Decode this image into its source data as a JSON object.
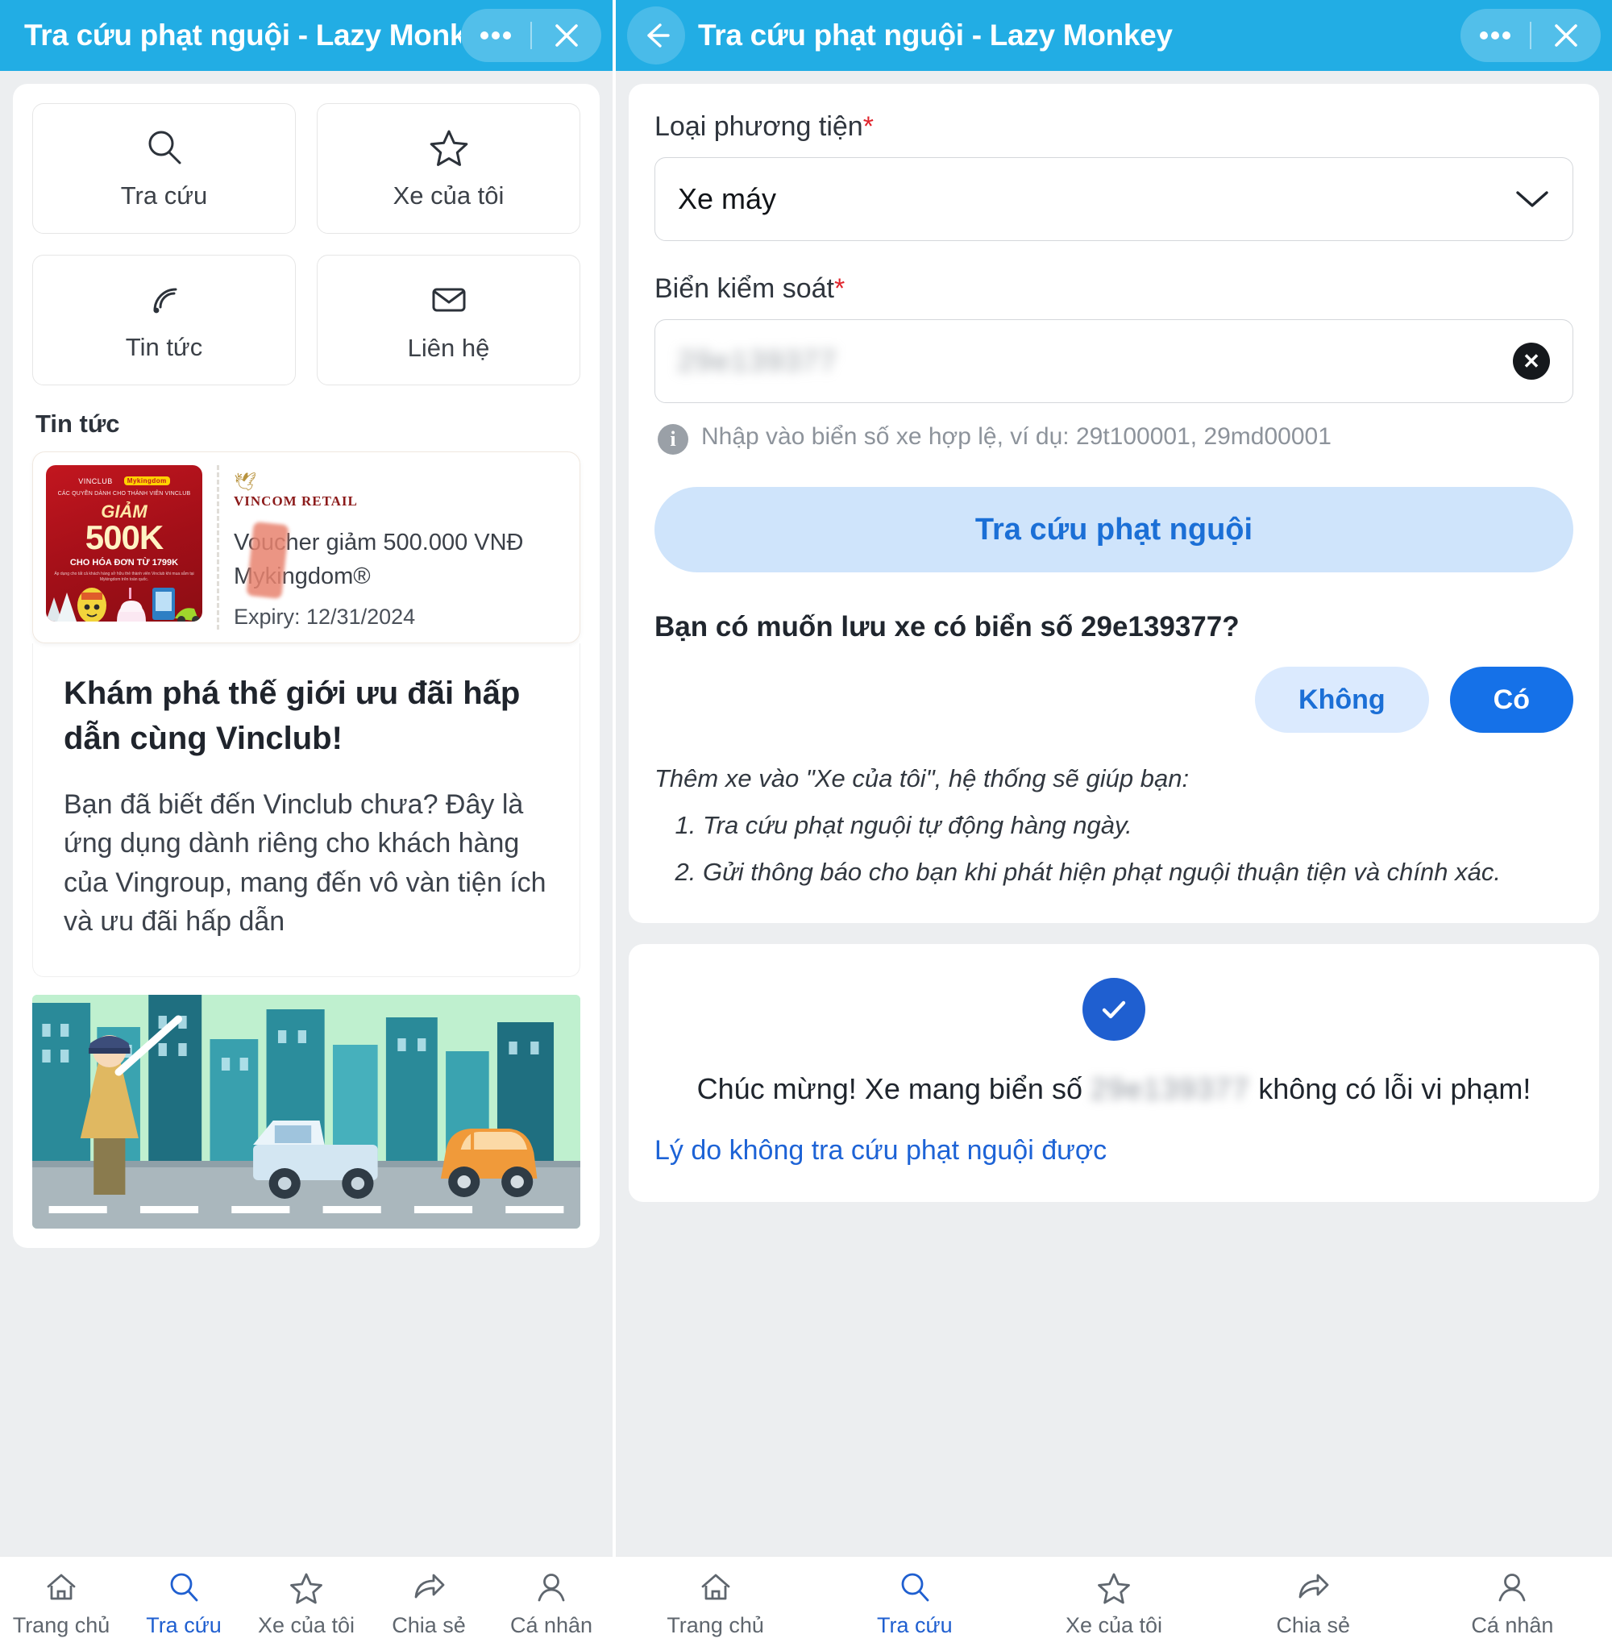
{
  "header": {
    "title": "Tra cứu phạt nguội - Lazy Monkey",
    "more_label": "•••",
    "close_label": "✕"
  },
  "left": {
    "tiles": [
      {
        "label": "Tra cứu",
        "icon": "search-icon"
      },
      {
        "label": "Xe của tôi",
        "icon": "star-icon"
      },
      {
        "label": "Tin tức",
        "icon": "rss-icon"
      },
      {
        "label": "Liên hệ",
        "icon": "mail-icon"
      }
    ],
    "news_section_title": "Tin tức",
    "voucher": {
      "brand_left": "VINCLUB",
      "brand_right": "Mykingdom",
      "promo_sub": "CÁC QUYỀN DÀNH CHO THÀNH VIÊN VINCLUB",
      "promo_giam": "GIẢM",
      "promo_amount": "500K",
      "promo_condition": "CHO HÓA ĐƠN TỪ 1799K",
      "promo_fine": "Áp dụng cho tất cả khách hàng sở hữu thẻ thành viên Vinclub khi mua sắm tại Mykingdom trên toàn quốc.",
      "retail_brand": "VINCOM RETAIL",
      "title": "Voucher giảm 500.000 VNĐ Mykingdom®",
      "expiry": "Expiry: 12/31/2024"
    },
    "article": {
      "heading": "Khám phá thế giới ưu đãi hấp dẫn cùng Vinclub!",
      "paragraph": "Bạn đã biết đến Vinclub chưa? Đây là ứng dụng dành riêng cho khách hàng của Vingroup, mang đến vô vàn tiện ích và ưu đãi hấp dẫn"
    }
  },
  "right": {
    "vehicle_type_label": "Loại phương tiện",
    "vehicle_type_value": "Xe máy",
    "plate_label": "Biển kiểm soát",
    "plate_value": "29e139377",
    "plate_hint": "Nhập vào biển số xe hợp lệ, ví dụ: 29t100001, 29md00001",
    "submit_label": "Tra cứu phạt nguội",
    "save_question": "Bạn có muốn lưu xe có biển số 29e139377?",
    "btn_no": "Không",
    "btn_yes": "Có",
    "note_intro": "Thêm xe vào \"Xe của tôi\", hệ thống sẽ giúp bạn:",
    "note_items": [
      "Tra cứu phạt nguội tự động hàng ngày.",
      "Gửi thông báo cho bạn khi phát hiện phạt nguội thuận tiện và chính xác."
    ],
    "result_prefix": "Chúc mừng! Xe mang biển số ",
    "result_plate": "29e139377",
    "result_suffix": " không có lỗi vi phạm!",
    "result_link": "Lý do không tra cứu phạt nguội được",
    "required_mark": "*"
  },
  "nav": {
    "items": [
      {
        "label": "Trang chủ",
        "icon": "home-icon",
        "active": false
      },
      {
        "label": "Tra cứu",
        "icon": "search-icon",
        "active": true
      },
      {
        "label": "Xe của tôi",
        "icon": "star-icon",
        "active": false
      },
      {
        "label": "Chia sẻ",
        "icon": "share-icon",
        "active": false
      },
      {
        "label": "Cá nhân",
        "icon": "person-icon",
        "active": false
      }
    ]
  },
  "colors": {
    "appbar": "#22ade4",
    "accent_blue": "#1571e8",
    "link_blue": "#1d63d6",
    "required_red": "#e0242c"
  }
}
